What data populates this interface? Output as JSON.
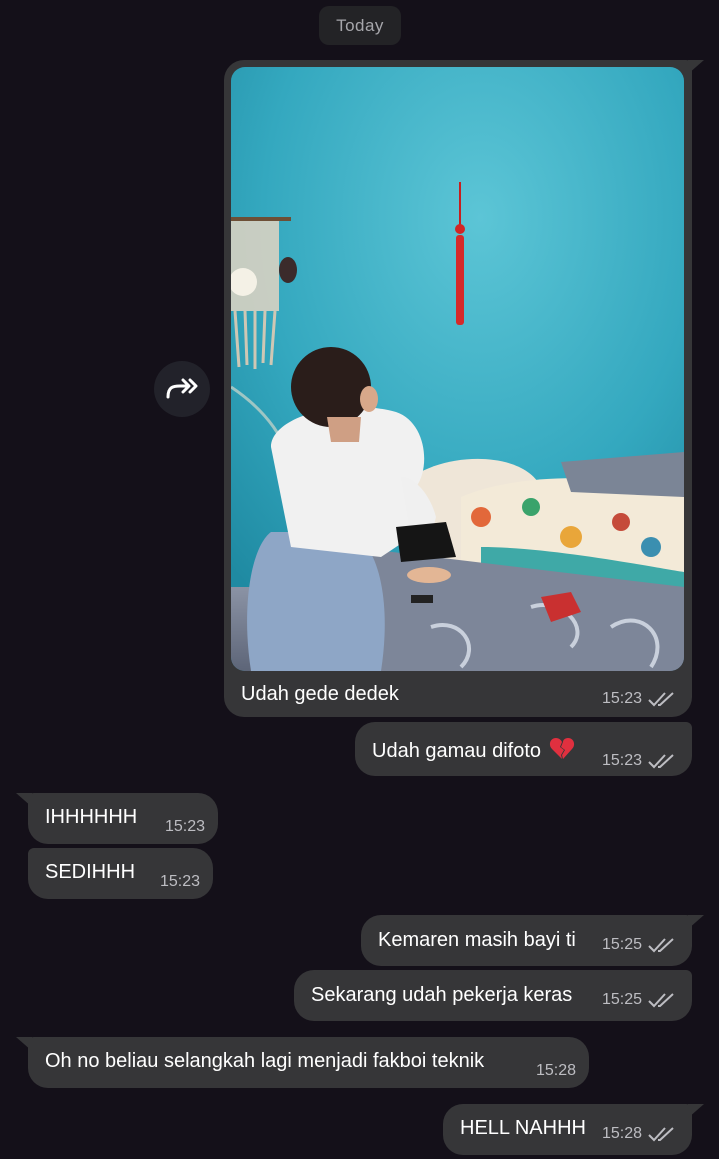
{
  "date_label": "Today",
  "messages": [
    {
      "direction": "out",
      "type": "photo",
      "caption": "Udah gede dedek",
      "time": "15:23",
      "status": "read"
    },
    {
      "direction": "out",
      "text": "Udah gamau difoto",
      "emoji": "broken-heart",
      "time": "15:23",
      "status": "read"
    },
    {
      "direction": "in",
      "text": "IHHHHHH",
      "time": "15:23"
    },
    {
      "direction": "in",
      "text": "SEDIHHH",
      "time": "15:23"
    },
    {
      "direction": "out",
      "text": "Kemaren masih bayi ti",
      "time": "15:25",
      "status": "read"
    },
    {
      "direction": "out",
      "text": "Sekarang udah pekerja keras",
      "time": "15:25",
      "status": "read"
    },
    {
      "direction": "in",
      "text": "Oh no beliau selangkah lagi menjadi fakboi teknik",
      "time": "15:28"
    },
    {
      "direction": "out",
      "text": "HELL NAHHH",
      "time": "15:28",
      "status": "read"
    }
  ],
  "icons": {
    "forward": "forward-arrow-icon",
    "read_receipt": "double-check-icon",
    "emoji": "broken-heart-icon"
  },
  "colors": {
    "background": "#141019",
    "bubble": "#363638",
    "meta_text": "#bdbdc2",
    "wall": "#35a9c0"
  }
}
